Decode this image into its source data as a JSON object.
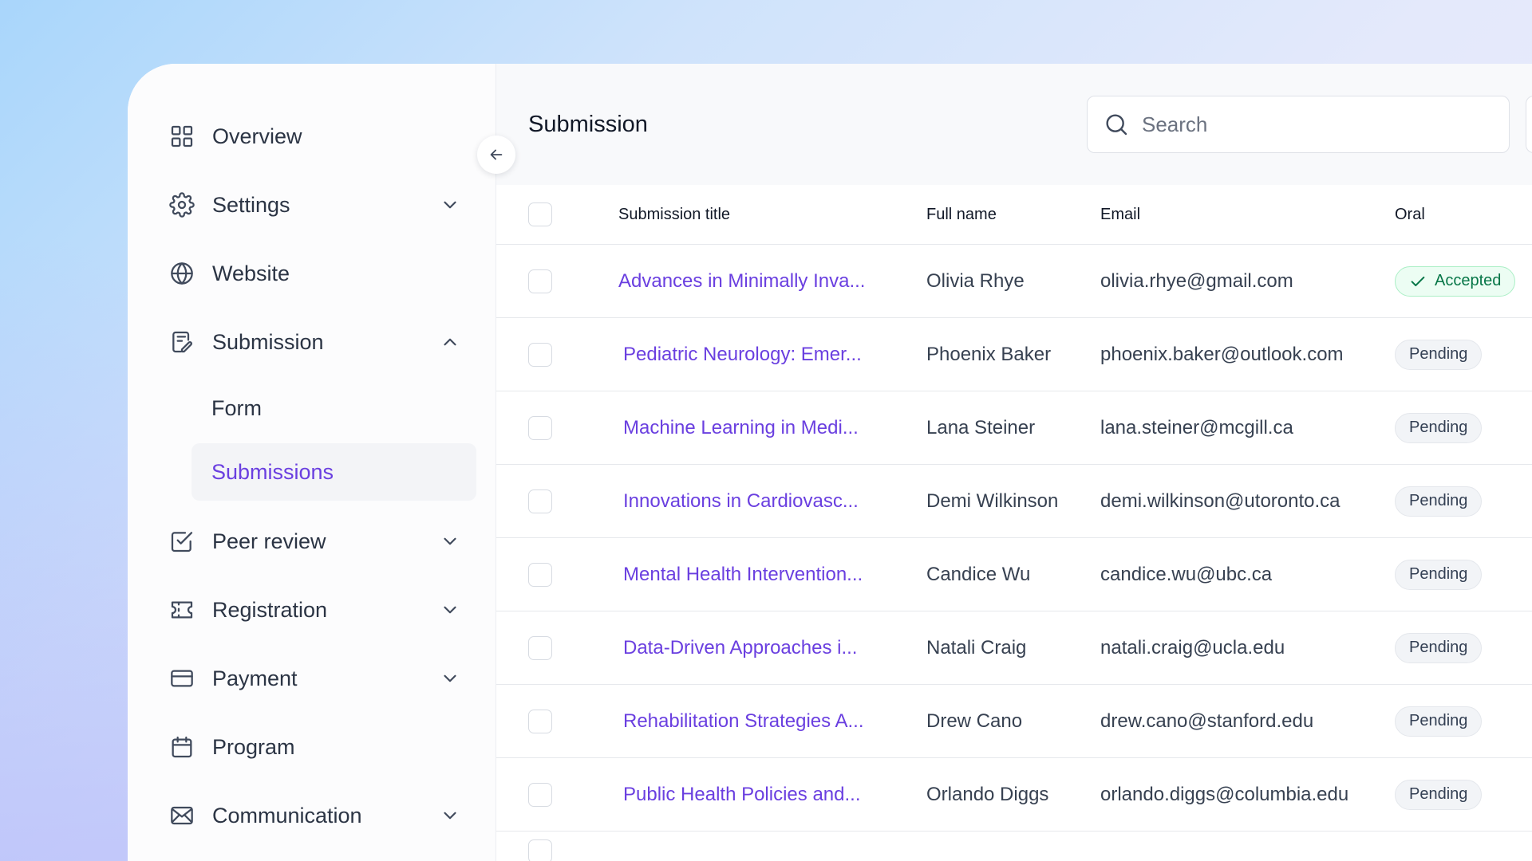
{
  "sidebar": {
    "items": [
      {
        "label": "Overview",
        "icon": "grid-icon",
        "has_chevron": false
      },
      {
        "label": "Settings",
        "icon": "gear-icon",
        "has_chevron": true,
        "expanded": false
      },
      {
        "label": "Website",
        "icon": "globe-icon",
        "has_chevron": false
      },
      {
        "label": "Submission",
        "icon": "submission-doc-icon",
        "has_chevron": true,
        "expanded": true,
        "children": [
          {
            "label": "Form",
            "active": false
          },
          {
            "label": "Submissions",
            "active": true
          }
        ]
      },
      {
        "label": "Peer review",
        "icon": "checkbox-icon",
        "has_chevron": true,
        "expanded": false
      },
      {
        "label": "Registration",
        "icon": "ticket-icon",
        "has_chevron": true,
        "expanded": false
      },
      {
        "label": "Payment",
        "icon": "credit-card-icon",
        "has_chevron": true,
        "expanded": false
      },
      {
        "label": "Program",
        "icon": "calendar-icon",
        "has_chevron": false
      },
      {
        "label": "Communication",
        "icon": "mail-icon",
        "has_chevron": true,
        "expanded": false
      }
    ]
  },
  "header": {
    "title": "Submission",
    "search": {
      "placeholder": "Search",
      "value": ""
    }
  },
  "table": {
    "columns": [
      "Submission title",
      "Full name",
      "Email",
      "Oral"
    ],
    "rows": [
      {
        "title": "Advances in Minimally Inva...",
        "name": "Olivia Rhye",
        "email": "olivia.rhye@gmail.com",
        "oral": "Accepted"
      },
      {
        "title": "Pediatric Neurology: Emer...",
        "name": "Phoenix Baker",
        "email": "phoenix.baker@outlook.com",
        "oral": "Pending"
      },
      {
        "title": "Machine Learning in Medi...",
        "name": "Lana Steiner",
        "email": "lana.steiner@mcgill.ca",
        "oral": "Pending"
      },
      {
        "title": "Innovations in Cardiovasc...",
        "name": "Demi Wilkinson",
        "email": "demi.wilkinson@utoronto.ca",
        "oral": "Pending"
      },
      {
        "title": "Mental Health Intervention...",
        "name": "Candice Wu",
        "email": "candice.wu@ubc.ca",
        "oral": "Pending"
      },
      {
        "title": "Data-Driven Approaches i...",
        "name": "Natali Craig",
        "email": "natali.craig@ucla.edu",
        "oral": "Pending"
      },
      {
        "title": "Rehabilitation Strategies A...",
        "name": "Drew Cano",
        "email": "drew.cano@stanford.edu",
        "oral": "Pending"
      },
      {
        "title": "Public Health Policies and...",
        "name": "Orlando Diggs",
        "email": "orlando.diggs@columbia.edu",
        "oral": "Pending"
      }
    ]
  },
  "colors": {
    "accent": "#6a3fe0",
    "accepted_text": "#067647",
    "accepted_bg": "#ecfdf3",
    "pending_bg": "#f2f4f7"
  }
}
